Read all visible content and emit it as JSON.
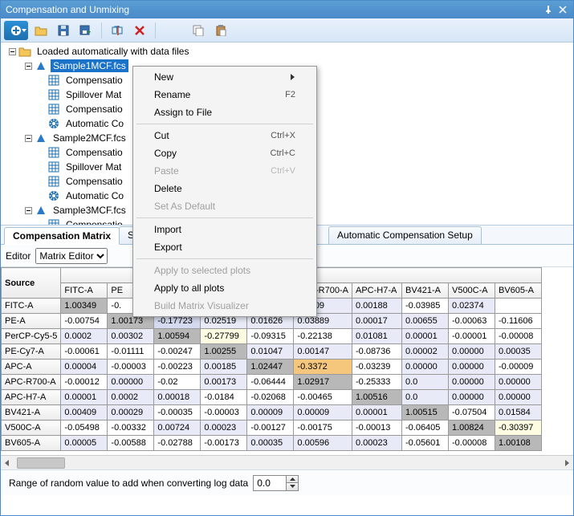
{
  "title": "Compensation and Unmixing",
  "tree": {
    "root": "Loaded automatically with data files",
    "s1": "Sample1MCF.fcs",
    "s2": "Sample2MCF.fcs",
    "s3": "Sample3MCF.fcs",
    "comp": "Compensatio",
    "spill": "Spillover Mat",
    "auto": "Automatic Co"
  },
  "tabs": {
    "t1": "Compensation Matrix",
    "t2": "S",
    "t3": "Automatic Compensation Setup"
  },
  "editor": {
    "label": "Editor",
    "value": "Matrix Editor"
  },
  "context": {
    "new": "New",
    "rename": "Rename",
    "rename_k": "F2",
    "assign": "Assign to File",
    "cut": "Cut",
    "cut_k": "Ctrl+X",
    "copy": "Copy",
    "copy_k": "Ctrl+C",
    "paste": "Paste",
    "paste_k": "Ctrl+V",
    "delete": "Delete",
    "default": "Set As Default",
    "import": "Import",
    "export": "Export",
    "applysel": "Apply to selected plots",
    "applyall": "Apply to all plots",
    "build": "Build Matrix Visualizer"
  },
  "matrix": {
    "source_h": "Source",
    "target_h": "et",
    "cols": [
      "FITC-A",
      "PE",
      "",
      "",
      "",
      "APC-R700-A",
      "APC-H7-A",
      "BV421-A",
      "V500C-A",
      "BV605-A"
    ],
    "rows": [
      {
        "n": "FITC-A",
        "v": [
          "1.00349",
          "-0.",
          "",
          "",
          "",
          "0.0009",
          "0.00188",
          "-0.03985",
          "0.02374"
        ],
        "cls": [
          "c-diag",
          "",
          "",
          "",
          "",
          "c-lt",
          "c-lt",
          "",
          "c-lt"
        ]
      },
      {
        "n": "PE-A",
        "v": [
          "-0.00754",
          "1.00173",
          "-0.17723",
          "0.02519",
          "0.01626",
          "0.03889",
          "0.00017",
          "0.00655",
          "-0.00063",
          "-0.11606"
        ],
        "cls": [
          "",
          "c-diag",
          "c-md",
          "c-lt",
          "c-lt",
          "c-lt",
          "c-lt",
          "c-lt",
          "",
          ""
        ]
      },
      {
        "n": "PerCP-Cy5-5",
        "v": [
          "0.0002",
          "0.00302",
          "1.00594",
          "-0.27799",
          "-0.09315",
          "-0.22138",
          "0.01081",
          "0.00001",
          "-0.00001",
          "-0.00008"
        ],
        "cls": [
          "c-lt",
          "c-lt",
          "c-diag",
          "c-yl",
          "",
          "",
          "c-lt",
          "c-lt",
          "",
          ""
        ]
      },
      {
        "n": "PE-Cy7-A",
        "v": [
          "-0.00061",
          "-0.01111",
          "-0.00247",
          "1.00255",
          "0.01047",
          "0.00147",
          "-0.08736",
          "0.00002",
          "0.00000",
          "0.00035"
        ],
        "cls": [
          "",
          "",
          "",
          "c-diag",
          "c-lt",
          "c-lt",
          "",
          "c-lt",
          "c-lt",
          "c-lt"
        ]
      },
      {
        "n": "APC-A",
        "v": [
          "0.00004",
          "-0.00003",
          "-0.00223",
          "0.00185",
          "1.02447",
          "-0.3372",
          "-0.03239",
          "0.00000",
          "0.00000",
          "-0.00009"
        ],
        "cls": [
          "c-lt",
          "",
          "",
          "c-lt",
          "c-diag",
          "c-or",
          "",
          "c-lt",
          "c-lt",
          ""
        ]
      },
      {
        "n": "APC-R700-A",
        "v": [
          "-0.00012",
          "0.00000",
          "-0.02",
          "0.00173",
          "-0.06444",
          "1.02917",
          "-0.25333",
          "0.0",
          "0.00000",
          "0.00000"
        ],
        "cls": [
          "",
          "c-lt",
          "",
          "c-lt",
          "",
          "c-diag",
          "",
          "c-lt",
          "c-lt",
          "c-lt"
        ]
      },
      {
        "n": "APC-H7-A",
        "v": [
          "0.00001",
          "0.0002",
          "0.00018",
          "-0.0184",
          "-0.02068",
          "-0.00465",
          "1.00516",
          "0.0",
          "0.00000",
          "0.00000"
        ],
        "cls": [
          "c-lt",
          "c-lt",
          "c-lt",
          "",
          "",
          "",
          "c-diag",
          "c-lt",
          "c-lt",
          "c-lt"
        ]
      },
      {
        "n": "BV421-A",
        "v": [
          "0.00409",
          "0.00029",
          "-0.00035",
          "-0.00003",
          "0.00009",
          "0.00009",
          "0.00001",
          "1.00515",
          "-0.07504",
          "0.01584"
        ],
        "cls": [
          "c-lt",
          "c-lt",
          "",
          "",
          "c-lt",
          "c-lt",
          "c-lt",
          "c-diag",
          "",
          "c-lt"
        ]
      },
      {
        "n": "V500C-A",
        "v": [
          "-0.05498",
          "-0.00332",
          "0.00724",
          "0.00023",
          "-0.00127",
          "-0.00175",
          "-0.00013",
          "-0.06405",
          "1.00824",
          "-0.30397"
        ],
        "cls": [
          "",
          "",
          "c-lt",
          "c-lt",
          "",
          "",
          "",
          "",
          "c-diag",
          "c-yl"
        ]
      },
      {
        "n": "BV605-A",
        "v": [
          "0.00005",
          "-0.00588",
          "-0.02788",
          "-0.00173",
          "0.00035",
          "0.00596",
          "0.00023",
          "-0.05601",
          "-0.00008",
          "1.00108"
        ],
        "cls": [
          "c-lt",
          "",
          "",
          "",
          "c-lt",
          "c-lt",
          "c-lt",
          "",
          "",
          "c-diag"
        ]
      }
    ]
  },
  "footer": {
    "label": "Range of random value to add when converting log data",
    "value": "0.0"
  }
}
